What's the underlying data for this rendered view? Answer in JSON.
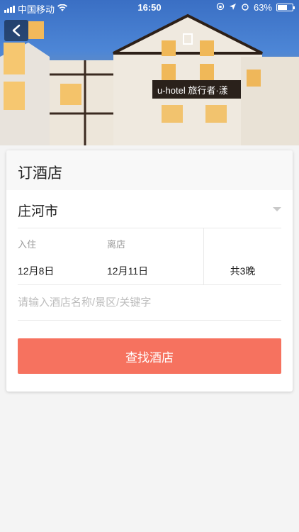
{
  "status_bar": {
    "carrier": "中国移动",
    "time": "16:50",
    "battery_text": "63%",
    "battery_level": 0.63
  },
  "hero": {
    "image_icon": "hotel-photo",
    "sign_text": "u-hotel 旅行者·漾"
  },
  "nav": {
    "back_icon": "chevron-left-icon"
  },
  "booking": {
    "title": "订酒店",
    "city": "庄河市",
    "checkin_label": "入住",
    "checkin_date": "12月8日",
    "checkout_label": "离店",
    "checkout_date": "12月11日",
    "nights_text": "共3晚",
    "search_placeholder": "请输入酒店名称/景区/关键字",
    "search_value": "",
    "submit_label": "查找酒店"
  },
  "colors": {
    "accent": "#f6725f",
    "background": "#f4f4f4"
  }
}
